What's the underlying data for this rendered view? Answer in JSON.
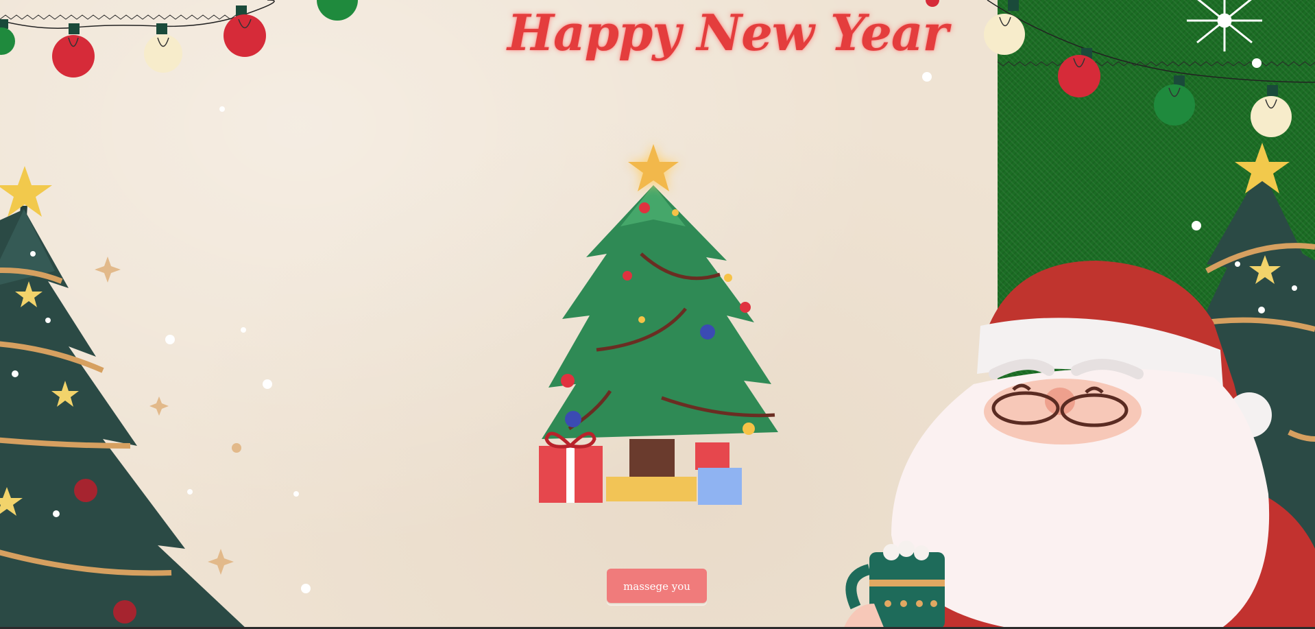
{
  "header": {
    "title": "Happy New Year"
  },
  "actions": {
    "message_button_label": "massege you"
  },
  "colors": {
    "background": "#efe3d3",
    "green_panel": "#1b6d24",
    "title_red": "#e43d3d",
    "button": "#f07b7b"
  },
  "decorations": {
    "left_lights": [
      "green-bulb",
      "red-bulb",
      "cream-bulb",
      "red-bulb",
      "green-bulb"
    ],
    "right_lights": [
      "cream-bulb",
      "red-bulb",
      "green-bulb",
      "cream-bulb"
    ],
    "center": "christmas-tree-with-gifts",
    "left": "christmas-tree",
    "right": [
      "santa-claus-with-mug",
      "christmas-tree",
      "snowflake"
    ]
  }
}
